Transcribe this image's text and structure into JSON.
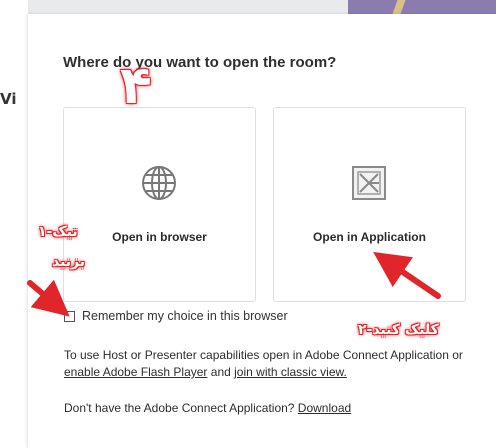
{
  "background": {
    "partial_text": "Vi"
  },
  "dialog": {
    "title": "Where do you want to open the room?",
    "options": [
      {
        "label": "Open in browser",
        "icon": "globe-icon"
      },
      {
        "label": "Open in Application",
        "icon": "adobe-connect-app-icon"
      }
    ],
    "remember": {
      "label": "Remember my choice in this browser",
      "checked": false
    },
    "info": {
      "prefix": "To use Host or Presenter capabilities open in Adobe Connect Application or ",
      "link1": "enable Adobe Flash Player",
      "middle": " and ",
      "link2": "join with classic view."
    },
    "download": {
      "prefix": "Don't have the Adobe Connect Application? ",
      "link": "Download"
    }
  },
  "annotations": {
    "step_number": "۴",
    "step1_line1": "۱-تیک",
    "step1_line2": "بزنید",
    "step2": "۲-کلیک کنید",
    "color": "#e0262b"
  }
}
